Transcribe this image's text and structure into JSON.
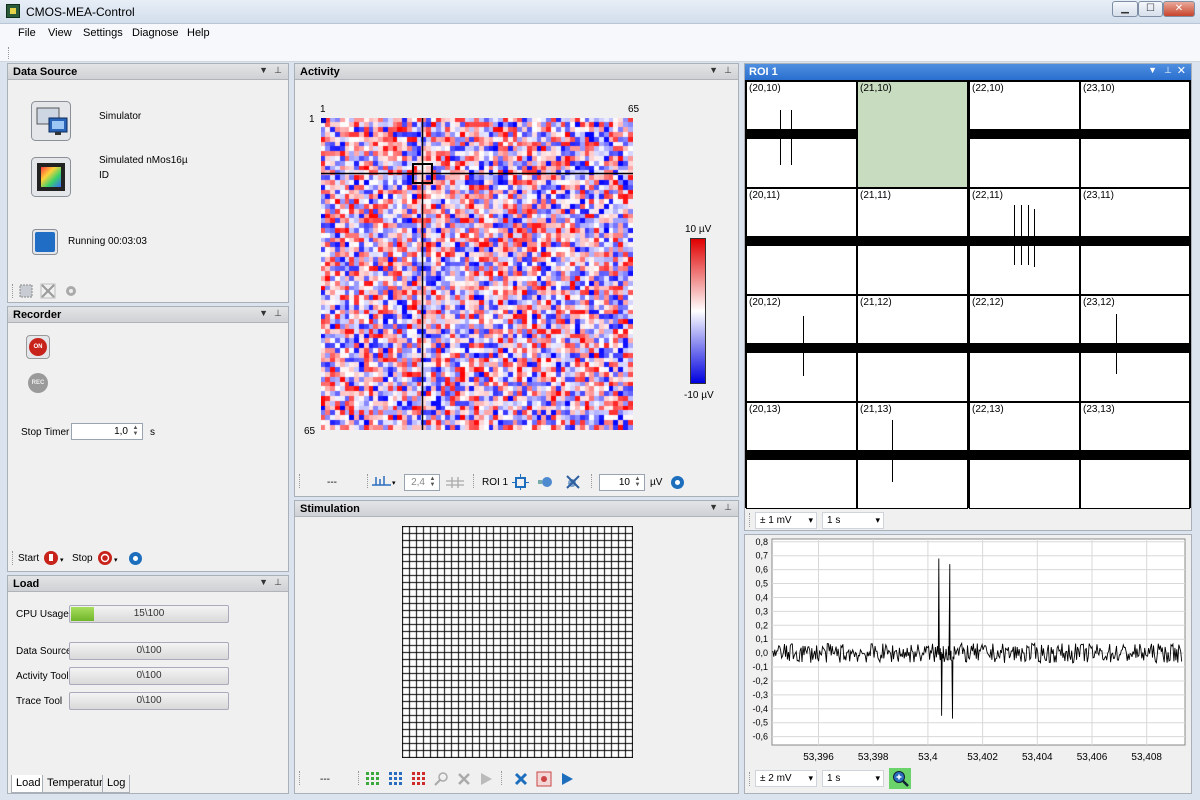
{
  "window": {
    "title": "CMOS-MEA-Control",
    "min": "▁",
    "max": "☐",
    "close": "✕"
  },
  "menu": [
    "File",
    "View",
    "Settings",
    "Diagnose",
    "Help"
  ],
  "data_source": {
    "title": "Data Source",
    "source_label": "Simulator",
    "chip_label": "Simulated nMos16µ",
    "chip_id": "ID",
    "status": "Running 00:03:03"
  },
  "recorder": {
    "title": "Recorder",
    "on_label": "ON",
    "rec_label": "REC",
    "stop_timer_label": "Stop Timer",
    "stop_timer_value": "1,0",
    "stop_timer_unit": "s",
    "start_label": "Start",
    "stop_label": "Stop"
  },
  "load": {
    "title": "Load",
    "rows": [
      {
        "label": "CPU Usage",
        "text": "15\\100",
        "value": 0.15
      },
      {
        "label": "Data Source",
        "text": "0\\100",
        "value": 0
      },
      {
        "label": "Activity Tool",
        "text": "0\\100",
        "value": 0
      },
      {
        "label": "Trace Tool",
        "text": "0\\100",
        "value": 0
      }
    ],
    "tabs": [
      "Load",
      "Temperature",
      "Log"
    ]
  },
  "activity": {
    "title": "Activity",
    "top_left": "1",
    "top_right": "65",
    "left_top": "1",
    "left_bottom": "65",
    "scale_max": "10 µV",
    "scale_min": "-10 µV",
    "status": "---",
    "threshold_value": "2,4",
    "roi_label": "ROI 1",
    "range_value": "10",
    "range_unit": "µV",
    "grid_cells": 65
  },
  "stimulation": {
    "title": "Stimulation",
    "status": "---",
    "grid_cells": 33
  },
  "roi": {
    "title": "ROI 1",
    "cells": [
      "(20,10)",
      "(21,10)",
      "(22,10)",
      "(23,10)",
      "(20,11)",
      "(21,11)",
      "(22,11)",
      "(23,11)",
      "(20,12)",
      "(21,12)",
      "(22,12)",
      "(23,12)",
      "(20,13)",
      "(21,13)",
      "(22,13)",
      "(23,13)"
    ],
    "selected_cell": "(21,10)",
    "amp_select": "± 1 mV",
    "time_select": "1 s"
  },
  "trace": {
    "amp_select": "± 2 mV",
    "time_select": "1 s",
    "accent": "#6ad36a"
  },
  "chart_data": {
    "type": "line",
    "title": "",
    "xlabel": "",
    "ylabel": "",
    "x_ticks": [
      "53,396",
      "53,398",
      "53,4",
      "53,402",
      "53,404",
      "53,406",
      "53,408"
    ],
    "y_ticks": [
      "0,8",
      "0,7",
      "0,6",
      "0,5",
      "0,4",
      "0,3",
      "0,2",
      "0,1",
      "0,0",
      "-0,1",
      "-0,2",
      "-0,3",
      "-0,4",
      "-0,5",
      "-0,6"
    ],
    "xlim": [
      53.3943,
      53.4094
    ],
    "ylim": [
      -0.66,
      0.82
    ],
    "grid": true,
    "series": [
      {
        "noise_amplitude": 0.07,
        "spikes": [
          {
            "x": 53.4004,
            "y": 0.68
          },
          {
            "x": 53.4005,
            "y": -0.45
          },
          {
            "x": 53.4008,
            "y": 0.64
          },
          {
            "x": 53.4009,
            "y": -0.47
          }
        ]
      }
    ]
  }
}
